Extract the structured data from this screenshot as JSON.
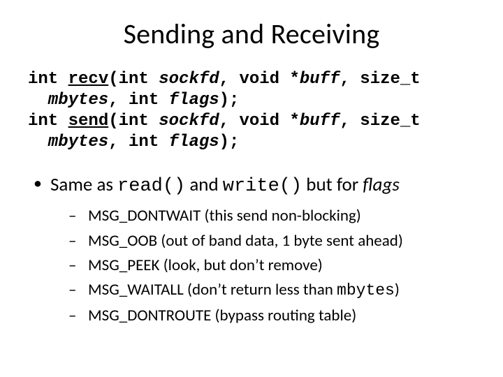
{
  "title": "Sending and Receiving",
  "sig": {
    "recv": {
      "ret": "int ",
      "name": "recv",
      "part1_open": "(int ",
      "p1": "sockfd",
      "sep1": ", void *",
      "p2": "buff",
      "sep2": ", size_t",
      "cont_p3": "mbytes",
      "sep3": ", int ",
      "p4": "flags",
      "close": ");"
    },
    "send": {
      "ret": "int ",
      "name": "send",
      "part1_open": "(int ",
      "p1": "sockfd",
      "sep1": ", void *",
      "p2": "buff",
      "sep2": ", size_t",
      "cont_p3": "mbytes",
      "sep3": ", int ",
      "p4": "flags",
      "close": ");"
    }
  },
  "main_bullet": {
    "t1": "Same as ",
    "c1": "read()",
    "t2": " and ",
    "c2": "write()",
    "t3": " but for ",
    "flags": "flags"
  },
  "flags_list": [
    {
      "text": "MSG_DONTWAIT (this send non-blocking)"
    },
    {
      "text": "MSG_OOB (out of band data, 1 byte sent ahead)"
    },
    {
      "text": "MSG_PEEK (look, but don’t remove)"
    },
    {
      "pre": "MSG_WAITALL (don’t return less than ",
      "code": "mbytes",
      "post": ")"
    },
    {
      "text": "MSG_DONTROUTE (bypass routing table)"
    }
  ]
}
